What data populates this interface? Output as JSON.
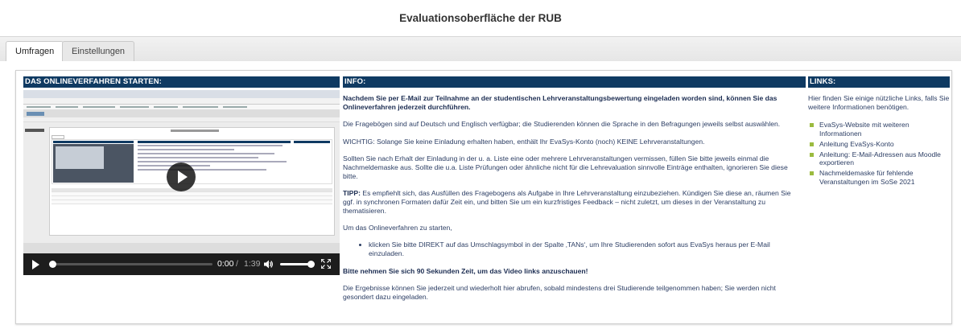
{
  "page": {
    "title": "Evaluationsoberfläche der RUB"
  },
  "tabs": [
    {
      "label": "Umfragen",
      "active": true
    },
    {
      "label": "Einstellungen",
      "active": false
    }
  ],
  "columns": {
    "start_header": "DAS ONLINEVERFAHREN STARTEN:",
    "info_header": "INFO:",
    "links_header": "LINKS:"
  },
  "video": {
    "current_time": "0:00",
    "separator": "/",
    "duration": "1:39",
    "progress": 0
  },
  "info": {
    "p1": "Nachdem Sie per E-Mail zur Teilnahme an der studentischen Lehrveranstaltungsbewertung eingeladen worden sind, können Sie das Onlineverfahren jederzeit durchführen.",
    "p2": "Die Fragebögen sind auf Deutsch und Englisch verfügbar; die Studierenden können die Sprache in den Befragungen jeweils selbst auswählen.",
    "p3": "WICHTIG: Solange Sie keine Einladung erhalten haben, enthält Ihr EvaSys-Konto (noch) KEINE Lehrveranstaltungen.",
    "p4": "Sollten Sie nach Erhalt der Einladung in der u. a. Liste eine oder mehrere Lehrveranstaltungen vermissen, füllen Sie bitte jeweils einmal die Nachmeldemaske aus. Sollte die u.a. Liste Prüfungen oder ähnliche nicht für die Lehrevaluation sinnvolle Einträge enthalten, ignorieren Sie diese bitte.",
    "tip_label": "TIPP:",
    "tip_text": " Es empfiehlt sich, das Ausfüllen des Fragebogens als Aufgabe in Ihre Lehrveranstaltung einzubeziehen. Kündigen Sie diese an, räumen Sie ggf. in synchronen Formaten dafür Zeit ein, und bitten Sie um ein kurzfristiges Feedback – nicht zuletzt, um dieses in der Veranstaltung zu thematisieren.",
    "p6": "Um das Onlineverfahren zu starten,",
    "bullet1": "klicken Sie bitte DIREKT auf das Umschlagsymbol in der Spalte ‚TANs‘, um Ihre Studierenden sofort aus EvaSys heraus per E-Mail einzuladen.",
    "p7": "Bitte nehmen Sie sich 90 Sekunden Zeit, um das Video links anzuschauen!",
    "p8": "Die Ergebnisse können Sie jederzeit und wiederholt hier abrufen, sobald mindestens drei Studierende teilgenommen haben; Sie werden nicht gesondert dazu eingeladen."
  },
  "links": {
    "intro": "Hier finden Sie einige nützliche Links, falls Sie weitere Informationen benötigen.",
    "items": [
      "EvaSys-Website mit weiteren Informationen",
      "Anleitung EvaSys-Konto",
      "Anleitung: E-Mail-Adressen aus Moodle exportieren",
      "Nachmeldemaske für fehlende Veranstaltungen im SoSe 2021"
    ]
  },
  "colors": {
    "header_bg": "#0f3a62",
    "bullet": "#9bbb3f",
    "text": "#2c3e64"
  }
}
